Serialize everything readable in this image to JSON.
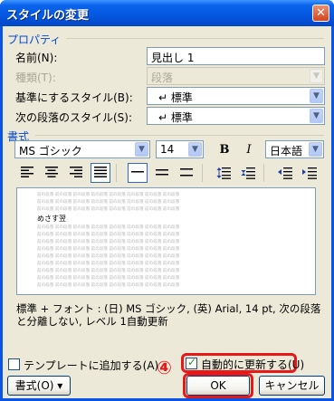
{
  "window": {
    "title": "スタイルの変更",
    "close_glyph": "✕"
  },
  "properties": {
    "section_label": "プロパティ",
    "name_label": "名前(N):",
    "name_value": "見出し 1",
    "type_label": "種類(T):",
    "type_value": "段落",
    "based_on_label": "基準にするスタイル(B):",
    "based_on_value": "↵ 標準",
    "next_label": "次の段落のスタイル(S):",
    "next_value": "↵ 標準"
  },
  "format": {
    "section_label": "書式",
    "font_value": "MS ゴシック",
    "size_value": "14",
    "bold_label": "B",
    "italic_label": "I",
    "lang_value": "日本語"
  },
  "preview": {
    "filler": "前の段落 前の段落 前の段落 前の段落 前の段落 前の段落 前の段落 前の段落",
    "sample": "めさす翌"
  },
  "description": "標準 + フォント : (日) MS ゴシック, (英) Arial, 14 pt, 次の段落と分離しない, レベル 1自動更新",
  "footer": {
    "add_template_label": "テンプレートに追加する(A)",
    "auto_update_label": "自動的に更新する(U)",
    "format_button": "書式(O) ▾",
    "ok_button": "OK",
    "cancel_button": "キャンセル",
    "step_marker": "④"
  },
  "colors": {
    "title_bar": "#0a54e3",
    "section": "#0046d5",
    "highlight": "#e81818"
  }
}
